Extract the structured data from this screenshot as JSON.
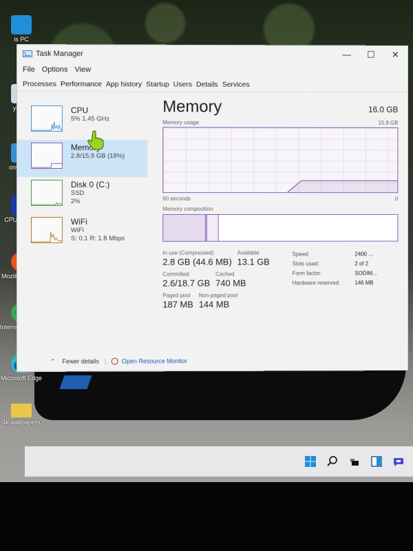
{
  "desktop": {
    "icons": [
      {
        "label": "is PC",
        "icon": "this-pc-icon",
        "color": "#1f8fd8"
      },
      {
        "label": "ycle B",
        "icon": "recycle-bin-icon",
        "color": "#2a7fd0"
      },
      {
        "label": "ontrol Pa",
        "icon": "control-panel-icon",
        "color": "#3a8ed6"
      },
      {
        "label": "CPUID CPU",
        "icon": "cpuid-icon",
        "color": "#1b3aa8"
      },
      {
        "label": "Mozilla Firefox",
        "icon": "firefox-icon",
        "color": "#e8551e"
      },
      {
        "label": "Internet Downloa",
        "icon": "idm-icon",
        "color": "#3aa84a"
      },
      {
        "label": "Microsoft Edge",
        "icon": "edge-icon",
        "color": "#1a8fc8"
      },
      {
        "label": "4k wallpapers",
        "icon": "folder-icon",
        "color": "#e8c84a"
      }
    ]
  },
  "window": {
    "title": "Task Manager",
    "controls": {
      "minimize": "—",
      "maximize": "☐",
      "close": "✕"
    },
    "menu": [
      "File",
      "Options",
      "View"
    ],
    "tabs": [
      "Processes",
      "Performance",
      "App history",
      "Startup",
      "Users",
      "Details",
      "Services"
    ],
    "active_tab": "Performance"
  },
  "sidebar": {
    "items": [
      {
        "name": "CPU",
        "sub1": "5% 1.45 GHz",
        "sub2": "",
        "selected": false
      },
      {
        "name": "Memory",
        "sub1": "2.8/15.9 GB (18%)",
        "sub2": "",
        "selected": true
      },
      {
        "name": "Disk 0 (C:)",
        "sub1": "SSD",
        "sub2": "2%",
        "selected": false
      },
      {
        "name": "WiFi",
        "sub1": "WiFi",
        "sub2": "S: 0.1 R: 1.8 Mbps",
        "selected": false
      }
    ]
  },
  "memory": {
    "title": "Memory",
    "total": "16.0 GB",
    "usage_label": "Memory usage",
    "usage_max": "15.9 GB",
    "time_label": "60 seconds",
    "time_end": "0",
    "composition_label": "Memory composition",
    "usage_history_fraction": [
      0.0,
      0.0,
      0.0,
      0.0,
      0.0,
      0.0,
      0.0,
      0.0,
      0.0,
      0.0,
      0.18,
      0.18,
      0.18,
      0.18,
      0.18,
      0.18,
      0.18,
      0.18
    ],
    "composition_fractions": {
      "in_use": 0.18,
      "modified": 0.005,
      "standby": 0.05,
      "free": 0.765
    },
    "stats": {
      "in_use_label": "In use (Compressed)",
      "in_use_value": "2.8 GB (44.6 MB)",
      "available_label": "Available",
      "available_value": "13.1 GB",
      "committed_label": "Committed",
      "committed_value": "2.6/18.7 GB",
      "cached_label": "Cached",
      "cached_value": "740 MB",
      "paged_label": "Paged pool",
      "paged_value": "187 MB",
      "nonpaged_label": "Non-paged pool",
      "nonpaged_value": "144 MB"
    },
    "details": [
      {
        "key": "Speed:",
        "value": "2400 ..."
      },
      {
        "key": "Slots used:",
        "value": "2 of 2"
      },
      {
        "key": "Form factor:",
        "value": "SODIM..."
      },
      {
        "key": "Hardware reserved:",
        "value": "146 MB"
      }
    ]
  },
  "footer": {
    "fewer_details": "Fewer details",
    "resource_monitor": "Open Resource Monitor"
  },
  "taskbar": {
    "icons": [
      "start-icon",
      "search-icon",
      "task-view-icon",
      "widgets-icon",
      "chat-icon"
    ]
  },
  "colors": {
    "accent": "#8b5fb0",
    "selection": "#cce4f7",
    "link": "#1a5fb4"
  }
}
